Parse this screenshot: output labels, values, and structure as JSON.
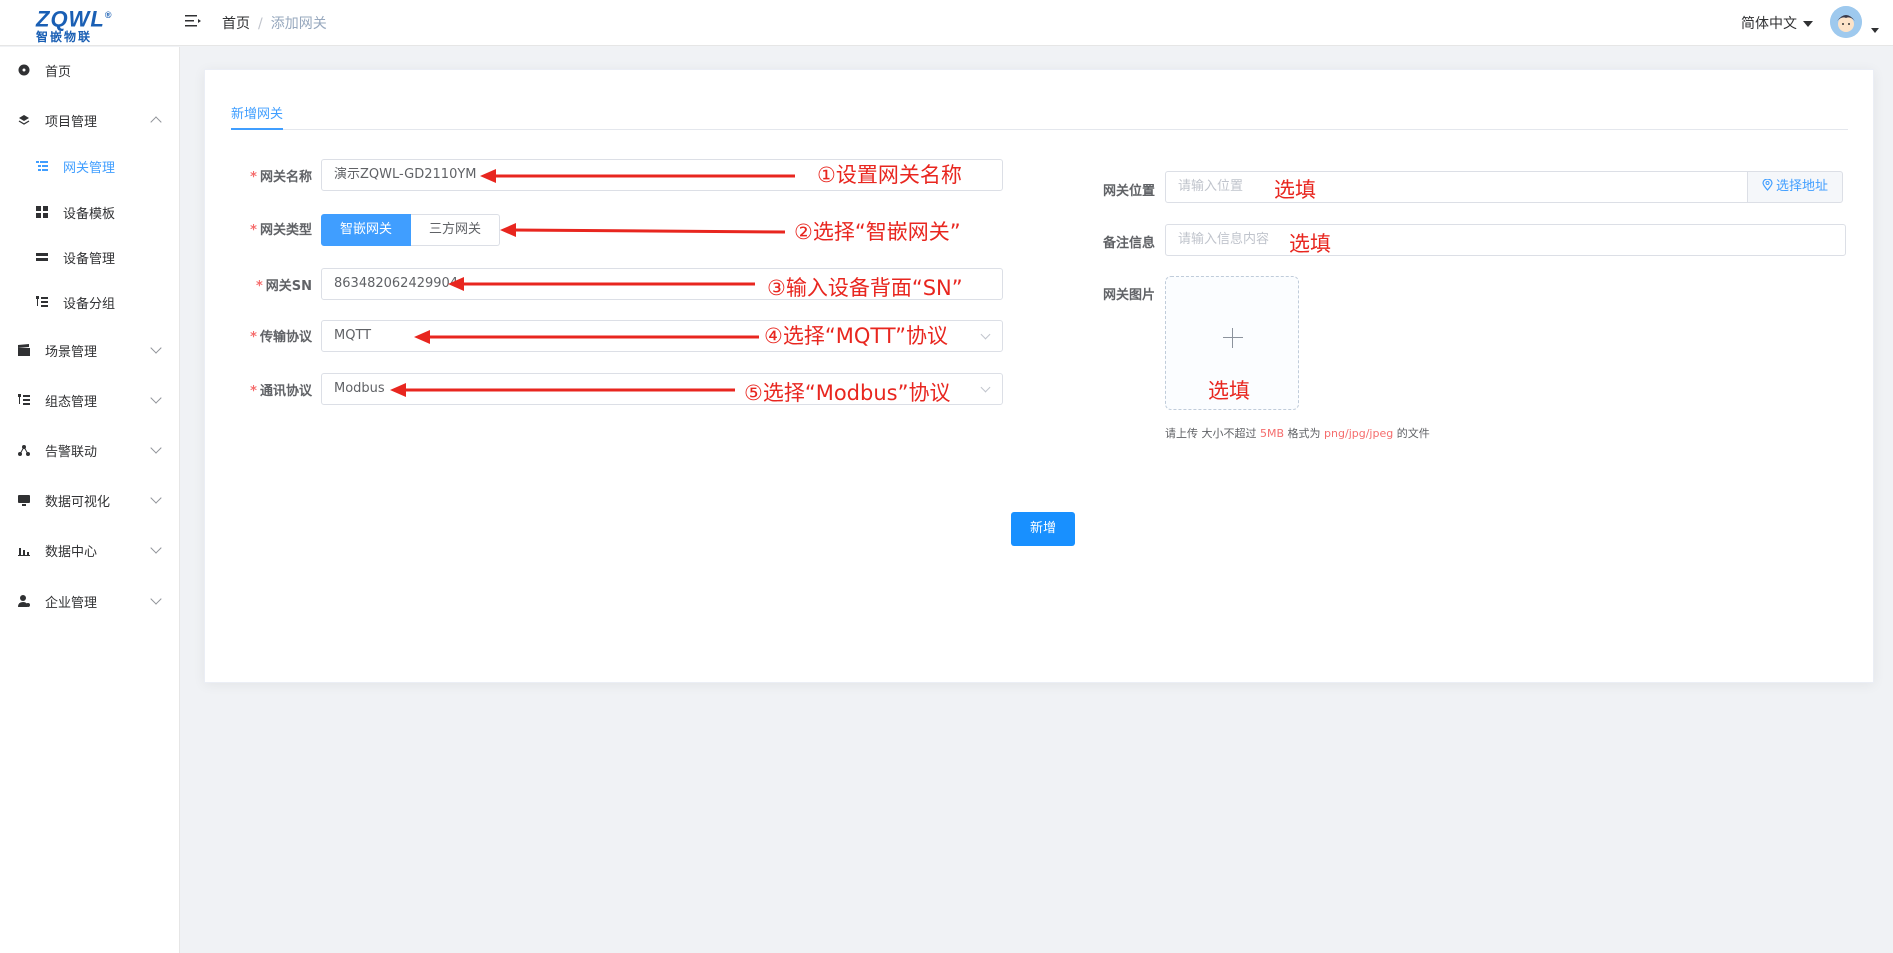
{
  "header": {
    "logo_top": "ZQWL",
    "logo_bottom": "智嵌物联",
    "breadcrumb_home": "首页",
    "breadcrumb_sep": "/",
    "breadcrumb_current": "添加网关",
    "language": "简体中文"
  },
  "sidebar": {
    "home": "首页",
    "project": "项目管理",
    "sub": [
      "网关管理",
      "设备模板",
      "设备管理",
      "设备分组"
    ],
    "scene": "场景管理",
    "config": "组态管理",
    "alarm": "告警联动",
    "visual": "数据可视化",
    "datacenter": "数据中心",
    "enterprise": "企业管理"
  },
  "tab": "新增网关",
  "form": {
    "required_mark": "*",
    "name_label": "网关名称",
    "name_value": "演示ZQWL-GD2110YM",
    "type_label": "网关类型",
    "type_on": "智嵌网关",
    "type_off": "三方网关",
    "sn_label": "网关SN",
    "sn_value": "863482062429904",
    "transport_label": "传输协议",
    "transport_value": "MQTT",
    "comm_label": "通讯协议",
    "comm_value": "Modbus",
    "location_label": "网关位置",
    "location_placeholder": "请输入位置",
    "location_button": "选择地址",
    "remark_label": "备注信息",
    "remark_placeholder": "请输入信息内容",
    "image_label": "网关图片",
    "tip_pre": "请上传 大小不超过 ",
    "tip_size": "5MB",
    "tip_mid": " 格式为 ",
    "tip_fmt": "png/jpg/jpeg",
    "tip_post": " 的文件",
    "submit": "新增"
  },
  "annotations": {
    "a1": "①设置网关名称",
    "a2": "②选择“智嵌网关”",
    "a3": "③输入设备背面“SN”",
    "a4": "④选择“MQTT”协议",
    "a5": "⑤选择“Modbus”协议",
    "optional": "选填"
  },
  "colors": {
    "primary": "#409eff",
    "annotation": "#e8261f"
  }
}
